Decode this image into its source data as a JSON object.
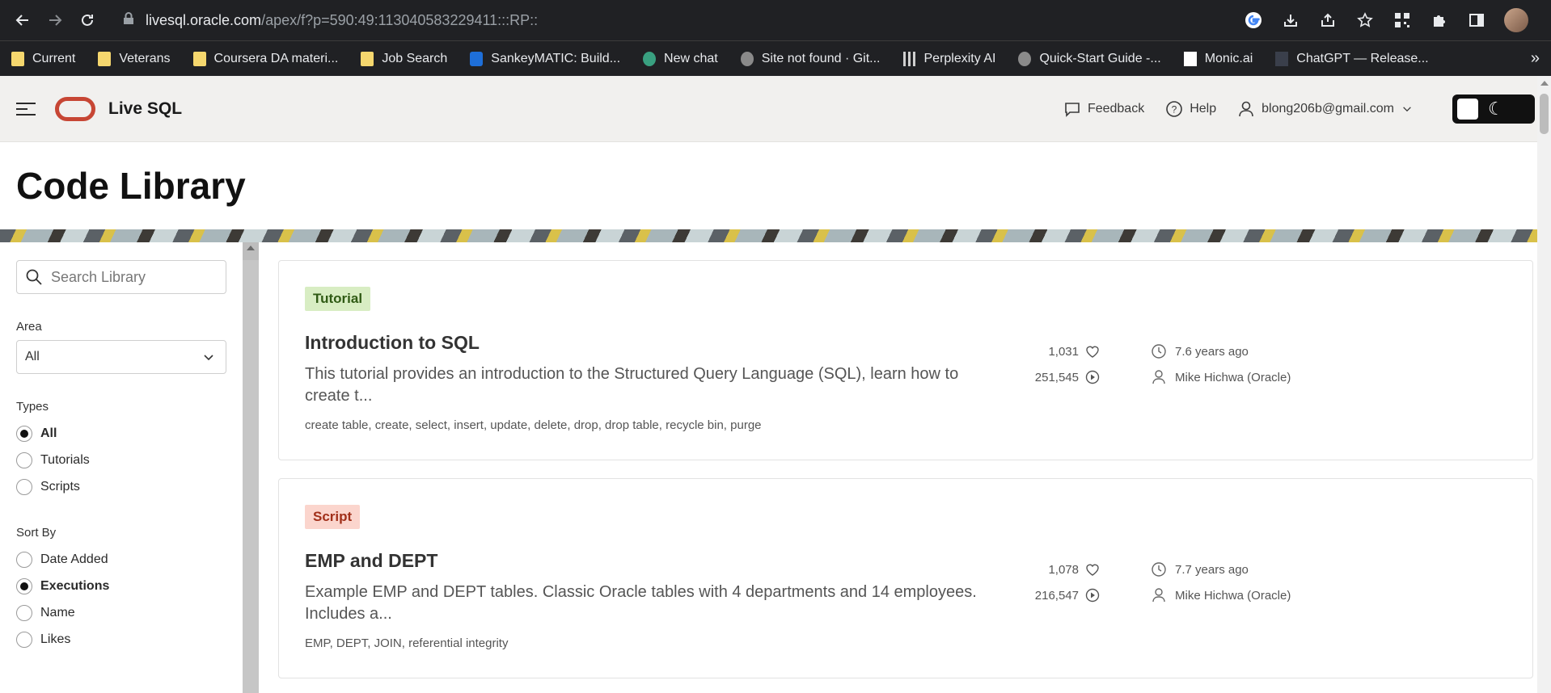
{
  "browser": {
    "url_host": "livesql.oracle.com",
    "url_path": "/apex/f?p=590:49:113040583229411:::RP::",
    "bookmarks": [
      {
        "label": "Current",
        "icon": "folder-icon"
      },
      {
        "label": "Veterans",
        "icon": "folder-icon"
      },
      {
        "label": "Coursera DA materi...",
        "icon": "folder-icon"
      },
      {
        "label": "Job Search",
        "icon": "folder-icon"
      },
      {
        "label": "SankeyMATIC: Build...",
        "icon": "sankeymatic-icon"
      },
      {
        "label": "New chat",
        "icon": "chatgpt-icon"
      },
      {
        "label": "Site not found · Git...",
        "icon": "globe-icon"
      },
      {
        "label": "Perplexity AI",
        "icon": "grid-icon"
      },
      {
        "label": "Quick-Start Guide -...",
        "icon": "globe-icon"
      },
      {
        "label": "Monic.ai",
        "icon": "monic-icon"
      },
      {
        "label": "ChatGPT — Release...",
        "icon": "github-icon"
      }
    ],
    "more_bookmarks": "»"
  },
  "header": {
    "app_title": "Live SQL",
    "feedback": "Feedback",
    "help": "Help",
    "user": "blong206b@gmail.com"
  },
  "page": {
    "title": "Code Library"
  },
  "sidebar": {
    "search_placeholder": "Search Library",
    "area_label": "Area",
    "area_value": "All",
    "types_label": "Types",
    "types": [
      "All",
      "Tutorials",
      "Scripts"
    ],
    "types_selected": "All",
    "sort_label": "Sort By",
    "sort": [
      "Date Added",
      "Executions",
      "Name",
      "Likes"
    ],
    "sort_selected": "Executions"
  },
  "cards": [
    {
      "badge": "Tutorial",
      "title": "Introduction to SQL",
      "description": "This tutorial provides an introduction to the Structured Query Language (SQL), learn how to create t...",
      "tags": "create table, create, select, insert, update, delete, drop, drop table, recycle bin, purge",
      "likes": "1,031",
      "executions": "251,545",
      "age": "7.6 years ago",
      "author": "Mike Hichwa (Oracle)"
    },
    {
      "badge": "Script",
      "title": "EMP and DEPT",
      "description": "Example EMP and DEPT tables. Classic Oracle tables with 4 departments and 14 employees. Includes a...",
      "tags": "EMP, DEPT, JOIN, referential integrity",
      "likes": "1,078",
      "executions": "216,547",
      "age": "7.7 years ago",
      "author": "Mike Hichwa (Oracle)"
    }
  ]
}
